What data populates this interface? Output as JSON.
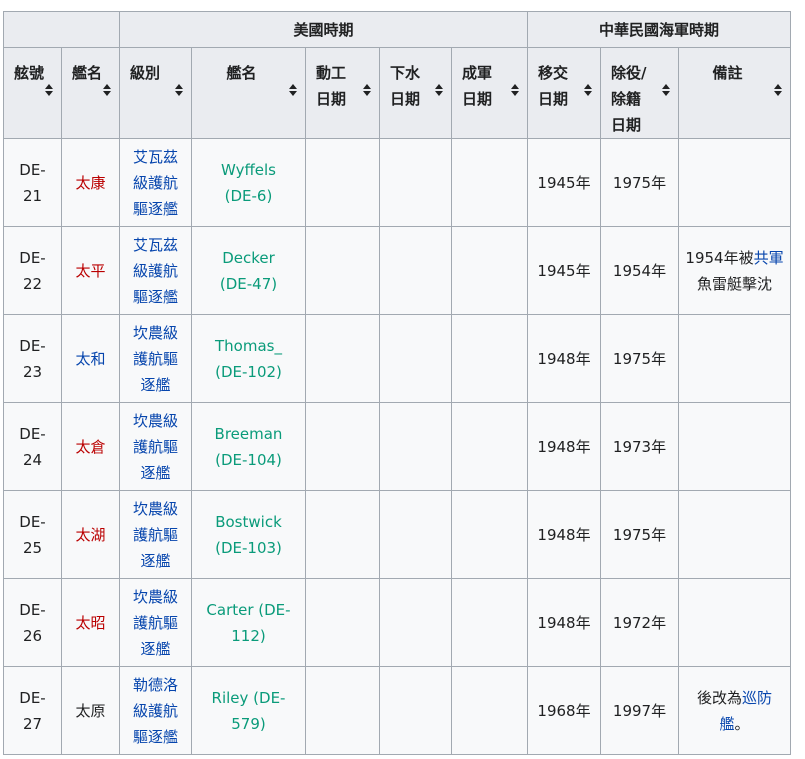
{
  "colors": {
    "redlink": "#ba0000",
    "link": "#0645ad",
    "interwiki": "#0a9b7a",
    "header_bg": "#eaecf0",
    "border": "#a2a9b1"
  },
  "header": {
    "group_us": "美國時期",
    "group_roc": "中華民國海軍時期",
    "cols": [
      "舷號",
      "艦名",
      "級別",
      "艦名",
      "動工日期",
      "下水日期",
      "成軍日期",
      "移交日期",
      "除役/除籍日期",
      "備註"
    ]
  },
  "rows": [
    {
      "hull": "DE-21",
      "name": "太康",
      "name_color": "red",
      "class": "艾瓦茲級護航驅逐艦",
      "us_name": "Wyffels (DE-6)",
      "transfer": "1945年",
      "decom": "1975年",
      "note_pre": "",
      "note_link1": "",
      "note_mid": "",
      "note_link2": "",
      "note_post": ""
    },
    {
      "hull": "DE-22",
      "name": "太平",
      "name_color": "red",
      "class": "艾瓦茲級護航驅逐艦",
      "us_name": "Decker (DE-47)",
      "transfer": "1945年",
      "decom": "1954年",
      "note_pre": "1954年被",
      "note_link1": "共軍",
      "note_mid": "魚雷艇擊沈",
      "note_link2": "",
      "note_post": ""
    },
    {
      "hull": "DE-23",
      "name": "太和",
      "name_color": "blue",
      "class": "坎農級護航驅逐艦",
      "us_name": "Thomas_ (DE-102)",
      "transfer": "1948年",
      "decom": "1975年",
      "note_pre": "",
      "note_link1": "",
      "note_mid": "",
      "note_link2": "",
      "note_post": ""
    },
    {
      "hull": "DE-24",
      "name": "太倉",
      "name_color": "red",
      "class": "坎農級護航驅逐艦",
      "us_name": "Breeman (DE-104)",
      "transfer": "1948年",
      "decom": "1973年",
      "note_pre": "",
      "note_link1": "",
      "note_mid": "",
      "note_link2": "",
      "note_post": ""
    },
    {
      "hull": "DE-25",
      "name": "太湖",
      "name_color": "red",
      "class": "坎農級護航驅逐艦",
      "us_name": "Bostwick (DE-103)",
      "transfer": "1948年",
      "decom": "1975年",
      "note_pre": "",
      "note_link1": "",
      "note_mid": "",
      "note_link2": "",
      "note_post": ""
    },
    {
      "hull": "DE-26",
      "name": "太昭",
      "name_color": "red",
      "class": "坎農級護航驅逐艦",
      "us_name": "Carter (DE-112)",
      "transfer": "1948年",
      "decom": "1972年",
      "note_pre": "",
      "note_link1": "",
      "note_mid": "",
      "note_link2": "",
      "note_post": ""
    },
    {
      "hull": "DE-27",
      "name": "太原",
      "name_color": "dark",
      "class": "勒德洛級護航驅逐艦",
      "us_name": "Riley (DE-579)",
      "transfer": "1968年",
      "decom": "1997年",
      "note_pre": "後改為",
      "note_link1": "",
      "note_mid": "",
      "note_link2": "巡防艦",
      "note_post": "。"
    }
  ]
}
